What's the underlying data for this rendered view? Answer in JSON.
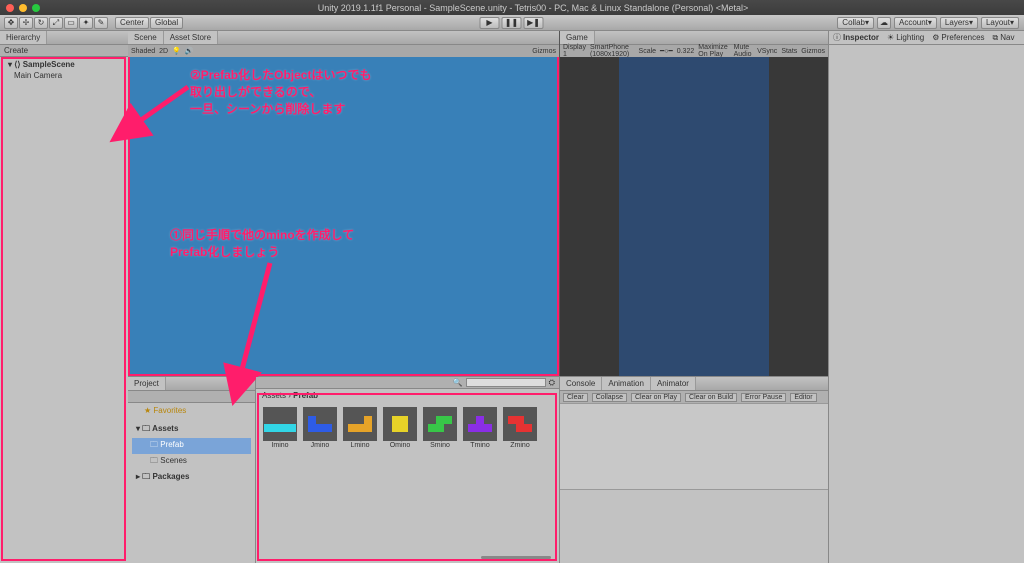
{
  "window": {
    "title": "Unity 2019.1.1f1 Personal - SampleScene.unity - Tetris00 - PC, Mac & Linux Standalone (Personal) <Metal>"
  },
  "toolbar": {
    "center_label": "Center",
    "global_label": "Global",
    "collab": "Collab",
    "account": "Account",
    "layers": "Layers",
    "layout": "Layout"
  },
  "hierarchy": {
    "tab": "Hierarchy",
    "create": "Create",
    "scene": "SampleScene",
    "items": [
      "Main Camera"
    ]
  },
  "scene": {
    "tab": "Scene",
    "tab2": "Asset Store",
    "shaded": "Shaded",
    "twod": "2D",
    "gizmos": "Gizmos"
  },
  "game": {
    "tab": "Game",
    "display": "Display 1",
    "aspect": "SmartPhone (1080x1920)",
    "scale_label": "Scale",
    "scale_val": "0.322",
    "opts": [
      "Maximize On Play",
      "Mute Audio",
      "VSync",
      "Stats",
      "Gizmos"
    ]
  },
  "annotations": {
    "a2": "②Prefab化したObjectはいつでも\n取り出しができるので、\n一旦、シーンから削除します",
    "a1": "①同じ手順で他のminoを作成して\nPrefab化しましょう"
  },
  "project": {
    "tab": "Project",
    "favorites": "Favorites",
    "assets": "Assets",
    "items": [
      "Prefab",
      "Scenes"
    ],
    "packages": "Packages"
  },
  "assets": {
    "breadcrumb_root": "Assets",
    "breadcrumb_child": "Prefab",
    "prefabs": [
      {
        "name": "Imino",
        "color": "c-cyan",
        "shape": "I"
      },
      {
        "name": "Jmino",
        "color": "c-blue",
        "shape": "J"
      },
      {
        "name": "Lmino",
        "color": "c-ora",
        "shape": "L"
      },
      {
        "name": "Omino",
        "color": "c-yel",
        "shape": "O"
      },
      {
        "name": "Smino",
        "color": "c-grn",
        "shape": "S"
      },
      {
        "name": "Tmino",
        "color": "c-pur",
        "shape": "T"
      },
      {
        "name": "Zmino",
        "color": "c-red",
        "shape": "Z"
      }
    ]
  },
  "console": {
    "tab": "Console",
    "tab2": "Animation",
    "tab3": "Animator",
    "buttons": [
      "Clear",
      "Collapse",
      "Clear on Play",
      "Clear on Build",
      "Error Pause",
      "Editor"
    ]
  },
  "inspector": {
    "tabs": [
      "Inspector",
      "Lighting",
      "Preferences",
      "Nav"
    ]
  }
}
